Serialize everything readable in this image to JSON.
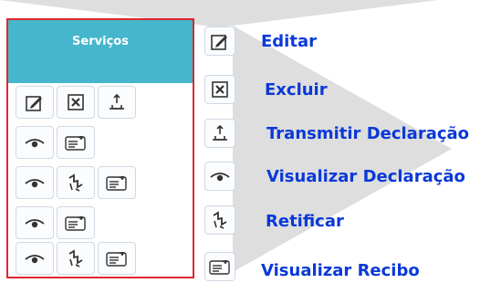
{
  "panel": {
    "title": "Serviços"
  },
  "legend": {
    "edit": "Editar",
    "delete": "Excluir",
    "transmit": "Transmitir Declaração",
    "view": "Visualizar Declaração",
    "rectify": "Retificar",
    "receipt": "Visualizar Recibo"
  },
  "rows": [
    {
      "icons": [
        "edit-icon",
        "delete-icon",
        "transmit-icon"
      ]
    },
    {
      "icons": [
        "view-declaration-icon",
        "view-receipt-icon"
      ]
    },
    {
      "icons": [
        "view-declaration-icon",
        "rectify-icon",
        "view-receipt-icon"
      ]
    },
    {
      "icons": [
        "view-declaration-icon",
        "view-receipt-icon"
      ]
    },
    {
      "icons": [
        "view-declaration-icon",
        "rectify-icon",
        "view-receipt-icon"
      ]
    }
  ],
  "colors": {
    "header": "#45b6cc",
    "border": "#e0262e",
    "legend_text": "#0a39d8"
  }
}
